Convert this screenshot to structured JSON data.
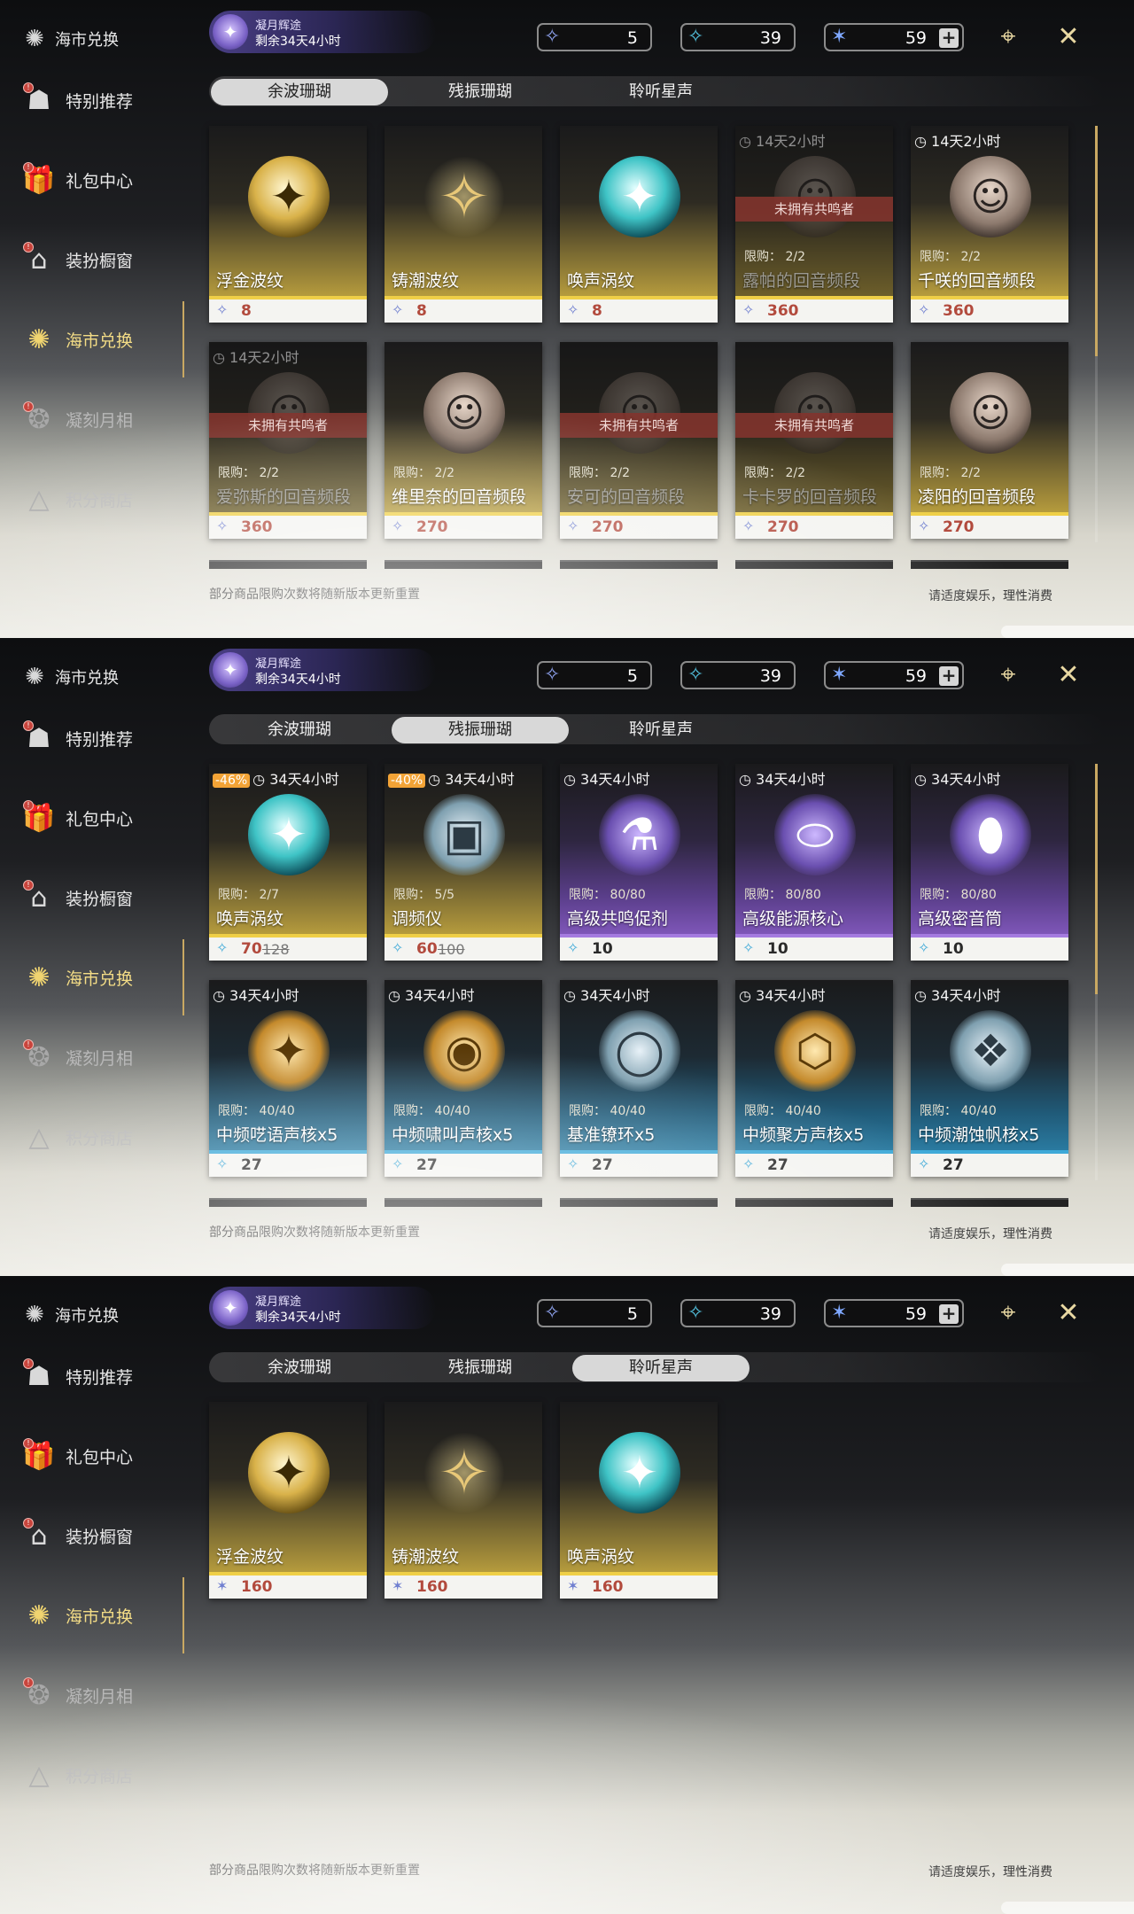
{
  "event": {
    "name": "凝月辉途",
    "time": "剩余34天4小时"
  },
  "currencies": [
    {
      "icon": "afterglow-coral-icon",
      "value": "5",
      "color": "#8fa3f0"
    },
    {
      "icon": "oscillated-coral-icon",
      "value": "39",
      "color": "#56c8e6"
    },
    {
      "icon": "star-sound-icon",
      "value": "59",
      "color": "#7fa8ff"
    }
  ],
  "sidebar": [
    {
      "label": "海市兑换",
      "icon": "coral-icon"
    },
    {
      "label": "特别推荐",
      "icon": "recommend-icon"
    },
    {
      "label": "礼包中心",
      "icon": "gift-icon"
    },
    {
      "label": "装扮橱窗",
      "icon": "wardrobe-icon"
    },
    {
      "label": "海市兑换",
      "icon": "coral-icon"
    },
    {
      "label": "凝刻月相",
      "icon": "moon-icon"
    },
    {
      "label": "积分商店",
      "icon": "points-icon"
    }
  ],
  "tabs": [
    "余波珊瑚",
    "残振珊瑚",
    "聆听星声"
  ],
  "footer": {
    "note": "部分商品限购次数将随新版本更新重置",
    "right": "请适度娱乐，理性消费"
  },
  "lock_text": "未拥有共鸣者",
  "screens": [
    {
      "active_tab": 0,
      "cards": [
        {
          "name": "浮金波纹",
          "price": "8",
          "style": "gold",
          "orb": "o-gold",
          "glyph": "✦"
        },
        {
          "name": "铸潮波纹",
          "price": "8",
          "style": "gold",
          "orb": "o-blade",
          "glyph": "✧"
        },
        {
          "name": "唤声涡纹",
          "price": "8",
          "style": "gold",
          "orb": "o-teal",
          "glyph": "✦"
        },
        {
          "name": "露帕的回音频段",
          "price": "360",
          "style": "gold",
          "orb": "o-portrait",
          "glyph": "☺",
          "timer": "14天2小时",
          "limit": "限购： 2/2",
          "locked": true
        },
        {
          "name": "千咲的回音频段",
          "price": "360",
          "style": "gold",
          "orb": "o-portrait",
          "glyph": "☺",
          "timer": "14天2小时",
          "limit": "限购： 2/2"
        },
        {
          "name": "爱弥斯的回音频段",
          "price": "360",
          "style": "gold",
          "orb": "o-portrait",
          "glyph": "☺",
          "timer": "14天2小时",
          "limit": "限购： 2/2",
          "locked": true
        },
        {
          "name": "维里奈的回音频段",
          "price": "270",
          "style": "gold",
          "orb": "o-portrait",
          "glyph": "☺",
          "limit": "限购： 2/2"
        },
        {
          "name": "安可的回音频段",
          "price": "270",
          "style": "gold",
          "orb": "o-portrait",
          "glyph": "☺",
          "limit": "限购： 2/2",
          "locked": true
        },
        {
          "name": "卡卡罗的回音频段",
          "price": "270",
          "style": "gold",
          "orb": "o-portrait",
          "glyph": "☺",
          "limit": "限购： 2/2",
          "locked": true
        },
        {
          "name": "凌阳的回音频段",
          "price": "270",
          "style": "gold",
          "orb": "o-portrait",
          "glyph": "☺",
          "limit": "限购： 2/2"
        }
      ]
    },
    {
      "active_tab": 1,
      "cards": [
        {
          "name": "唤声涡纹",
          "price": "70",
          "old_price": "128",
          "discount": "-46%",
          "style": "gold",
          "orb": "o-teal",
          "glyph": "✦",
          "timer": "34天4小时",
          "limit": "限购： 2/7"
        },
        {
          "name": "调频仪",
          "price": "60",
          "old_price": "100",
          "discount": "-40%",
          "style": "gold",
          "orb": "o-item-blue",
          "glyph": "▣",
          "timer": "34天4小时",
          "limit": "限购： 5/5"
        },
        {
          "name": "高级共鸣促剂",
          "price": "10",
          "style": "purple",
          "orb": "o-item-purple",
          "glyph": "⚗",
          "timer": "34天4小时",
          "limit": "限购： 80/80"
        },
        {
          "name": "高级能源核心",
          "price": "10",
          "style": "purple",
          "orb": "o-item-purple",
          "glyph": "⬭",
          "timer": "34天4小时",
          "limit": "限购： 80/80"
        },
        {
          "name": "高级密音筒",
          "price": "10",
          "style": "purple",
          "orb": "o-item-purple",
          "glyph": "⬮",
          "timer": "34天4小时",
          "limit": "限购： 80/80"
        },
        {
          "name": "中频呓语声核x5",
          "price": "27",
          "style": "blue",
          "orb": "o-item-gold",
          "glyph": "✦",
          "timer": "34天4小时",
          "limit": "限购： 40/40"
        },
        {
          "name": "中频啸叫声核x5",
          "price": "27",
          "style": "blue",
          "orb": "o-item-gold",
          "glyph": "◉",
          "timer": "34天4小时",
          "limit": "限购： 40/40"
        },
        {
          "name": "基准镣环x5",
          "price": "27",
          "style": "blue",
          "orb": "o-item-blue",
          "glyph": "◯",
          "timer": "34天4小时",
          "limit": "限购： 40/40"
        },
        {
          "name": "中频聚方声核x5",
          "price": "27",
          "style": "blue",
          "orb": "o-item-gold",
          "glyph": "⬡",
          "timer": "34天4小时",
          "limit": "限购： 40/40"
        },
        {
          "name": "中频潮蚀帆核x5",
          "price": "27",
          "style": "blue",
          "orb": "o-item-blue",
          "glyph": "❖",
          "timer": "34天4小时",
          "limit": "限购： 40/40"
        }
      ]
    },
    {
      "active_tab": 2,
      "cards": [
        {
          "name": "浮金波纹",
          "price": "160",
          "style": "gold",
          "orb": "o-gold",
          "glyph": "✦",
          "pay": "star"
        },
        {
          "name": "铸潮波纹",
          "price": "160",
          "style": "gold",
          "orb": "o-blade",
          "glyph": "✧",
          "pay": "star"
        },
        {
          "name": "唤声涡纹",
          "price": "160",
          "style": "gold",
          "orb": "o-teal",
          "glyph": "✦",
          "pay": "star"
        }
      ]
    }
  ]
}
